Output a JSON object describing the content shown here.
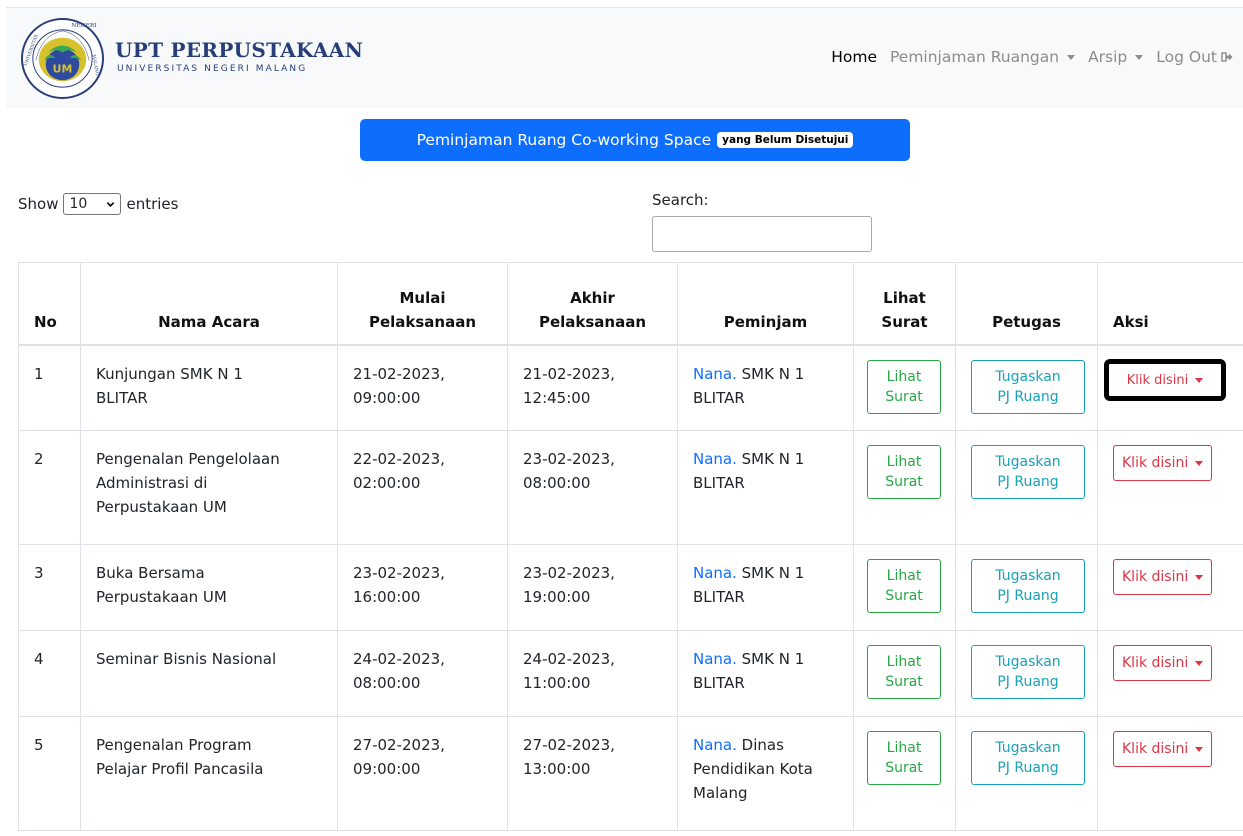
{
  "brand": {
    "title": "UPT PERPUSTAKAAN",
    "subtitle": "UNIVERSITAS NEGERI MALANG",
    "seal_text": "NEGERI",
    "seal_text2": "UNIVERSITAS",
    "seal_text3": "MALANG",
    "seal_mark": "UM"
  },
  "nav": {
    "home": "Home",
    "peminjaman": "Peminjaman Ruangan",
    "arsip": "Arsip",
    "logout": "Log Out"
  },
  "page_title": {
    "main": "Peminjaman Ruang Co-working Space",
    "badge": "yang Belum Disetujui"
  },
  "length_menu": {
    "prefix": "Show",
    "value": "10",
    "suffix": "entries"
  },
  "search": {
    "label": "Search:",
    "value": ""
  },
  "table": {
    "headers": {
      "no": "No",
      "nama": "Nama Acara",
      "mulai_1": "Mulai",
      "mulai_2": "Pelaksanaan",
      "akhir_1": "Akhir",
      "akhir_2": "Pelaksanaan",
      "peminjam": "Peminjam",
      "lihat_1": "Lihat",
      "lihat_2": "Surat",
      "petugas": "Petugas",
      "aksi": "Aksi"
    },
    "rows": [
      {
        "no": "1",
        "nama_lines": [
          "Kunjungan SMK N 1",
          "BLITAR"
        ],
        "mulai_lines": [
          "21-02-2023,",
          "09:00:00"
        ],
        "akhir_lines": [
          "21-02-2023,",
          "12:45:00"
        ],
        "peminjam_name": "Nana.",
        "peminjam_lines": [
          " SMK N 1",
          "BLITAR"
        ]
      },
      {
        "no": "2",
        "nama_lines": [
          "Pengenalan Pengelolaan",
          "Administrasi di",
          "Perpustakaan UM"
        ],
        "mulai_lines": [
          "22-02-2023,",
          "02:00:00"
        ],
        "akhir_lines": [
          "23-02-2023,",
          "08:00:00"
        ],
        "peminjam_name": "Nana.",
        "peminjam_lines": [
          " SMK N 1",
          "BLITAR"
        ]
      },
      {
        "no": "3",
        "nama_lines": [
          "Buka Bersama",
          "Perpustakaan UM"
        ],
        "mulai_lines": [
          "23-02-2023,",
          "16:00:00"
        ],
        "akhir_lines": [
          "23-02-2023,",
          "19:00:00"
        ],
        "peminjam_name": "Nana.",
        "peminjam_lines": [
          " SMK N 1",
          "BLITAR"
        ]
      },
      {
        "no": "4",
        "nama_lines": [
          "Seminar Bisnis Nasional"
        ],
        "mulai_lines": [
          "24-02-2023,",
          "08:00:00"
        ],
        "akhir_lines": [
          "24-02-2023,",
          "11:00:00"
        ],
        "peminjam_name": "Nana.",
        "peminjam_lines": [
          " SMK N 1",
          "BLITAR"
        ]
      },
      {
        "no": "5",
        "nama_lines": [
          "Pengenalan Program",
          "Pelajar Profil Pancasila"
        ],
        "mulai_lines": [
          "27-02-2023,",
          "09:00:00"
        ],
        "akhir_lines": [
          "27-02-2023,",
          "13:00:00"
        ],
        "peminjam_name": "Nana.",
        "peminjam_lines": [
          " Dinas",
          "Pendidikan Kota",
          "Malang"
        ]
      }
    ],
    "buttons": {
      "lihat_1": "Lihat",
      "lihat_2": "Surat",
      "tugaskan_1": "Tugaskan",
      "tugaskan_2": "PJ Ruang",
      "klik": "Klik disini"
    }
  },
  "colors": {
    "primary": "#0d6efd",
    "success": "#28a745",
    "info": "#17a2b8",
    "danger": "#dc3545",
    "brand_navy": "#283e7a"
  }
}
